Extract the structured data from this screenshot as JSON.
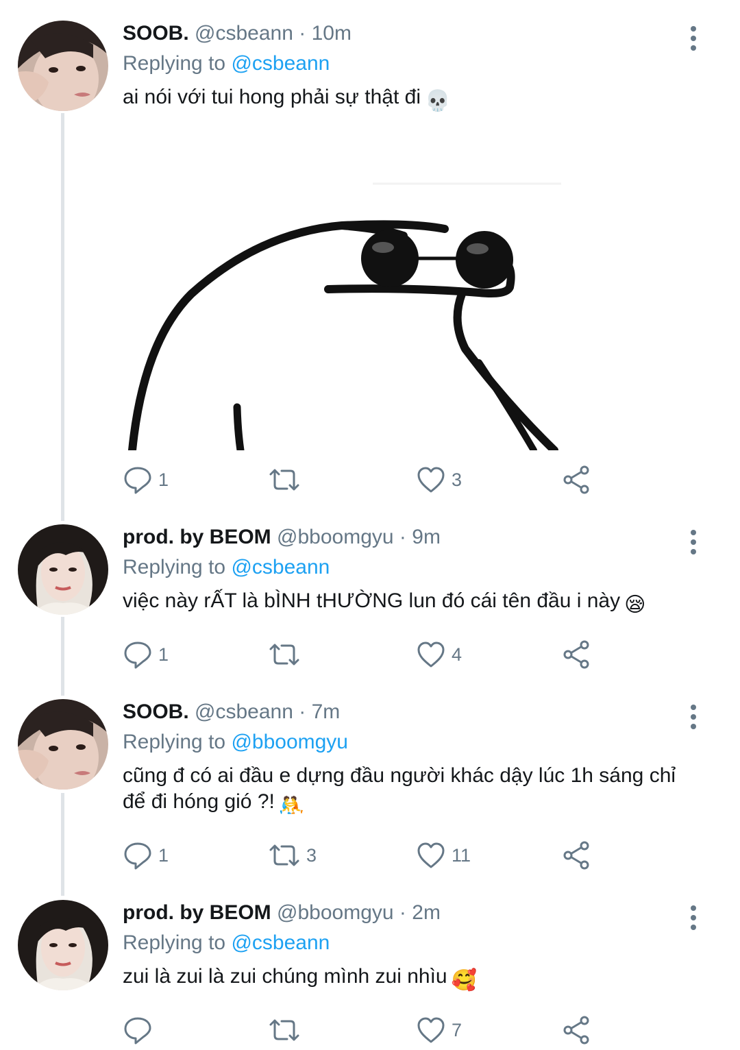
{
  "tweets": [
    {
      "name": "SOOB.",
      "handle": "@csbeann",
      "time": "10m",
      "replying_prefix": "Replying to",
      "replying_to": "@csbeann",
      "text": "ai nói với tui hong phải sự thật đi",
      "emoji": "💀",
      "avatar": "avatar-soob",
      "has_media": true,
      "counts": {
        "replies": "1",
        "retweets": "",
        "likes": "3"
      }
    },
    {
      "name": "prod. by BEOM",
      "handle": "@bboomgyu",
      "time": "9m",
      "replying_prefix": "Replying to",
      "replying_to": "@csbeann",
      "text": "việc này rẤT là bÌNH tHƯỜNG lun đó cái tên đầu i này",
      "emoji": "😪",
      "avatar": "avatar-beom",
      "has_media": false,
      "counts": {
        "replies": "1",
        "retweets": "",
        "likes": "4"
      }
    },
    {
      "name": "SOOB.",
      "handle": "@csbeann",
      "time": "7m",
      "replying_prefix": "Replying to",
      "replying_to": "@bboomgyu",
      "text": "cũng đ có ai đầu e dựng đầu người khác dậy lúc 1h sáng chỉ để đi hóng gió ?!",
      "emoji": "🤼",
      "avatar": "avatar-soob",
      "has_media": false,
      "counts": {
        "replies": "1",
        "retweets": "3",
        "likes": "11"
      }
    },
    {
      "name": "prod. by BEOM",
      "handle": "@bboomgyu",
      "time": "2m",
      "replying_prefix": "Replying to",
      "replying_to": "@csbeann",
      "text": "zui là zui là zui chúng mình zui nhìu",
      "emoji": "🥰",
      "avatar": "avatar-beom",
      "has_media": false,
      "counts": {
        "replies": "",
        "retweets": "",
        "likes": "7"
      }
    }
  ],
  "separator": "·",
  "colors": {
    "link": "#1da1f2",
    "muted": "#657786",
    "text": "#14171a",
    "thread_line": "#dfe3e7"
  },
  "icons": [
    "reply-icon",
    "retweet-icon",
    "like-icon",
    "share-icon",
    "more-icon"
  ]
}
